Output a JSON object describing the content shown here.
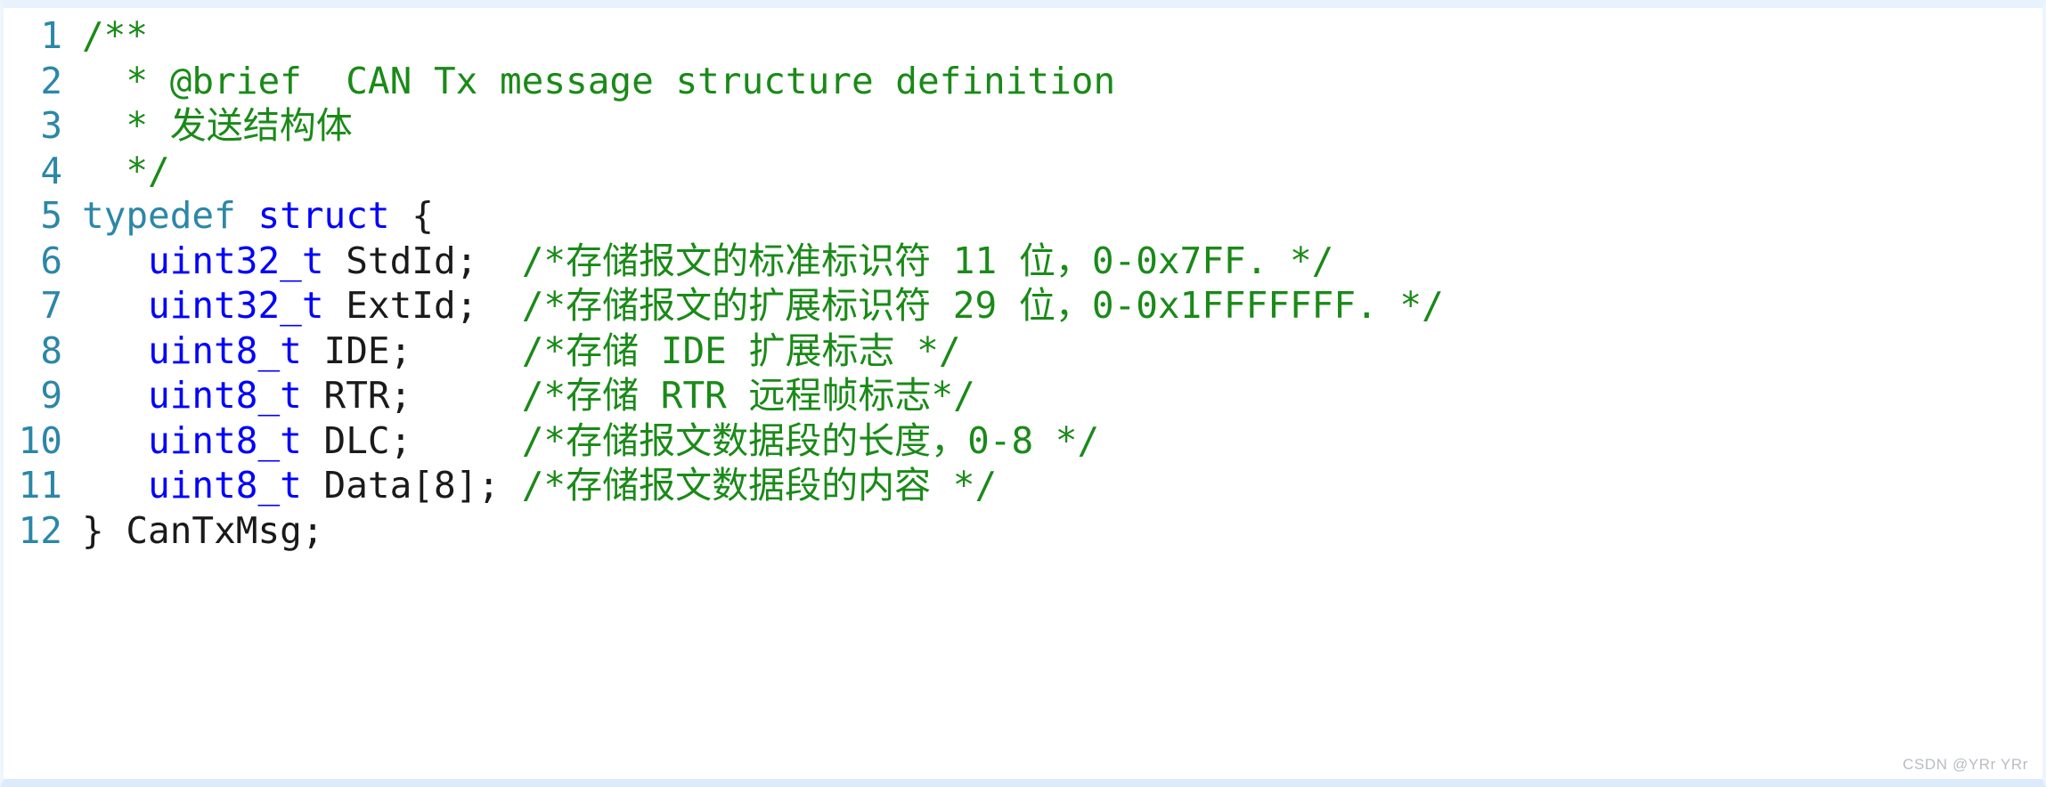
{
  "card": {
    "language": "c",
    "accent_top_color": "#e8f2fd",
    "accent_bottom_color": "#dcebfb",
    "background_color": "#ffffff"
  },
  "colors": {
    "line_number": "#2b87a8",
    "comment": "#1a8a18",
    "keyword_typedef": "#2b87a8",
    "keyword_struct": "#0000ff",
    "type": "#0000ff",
    "plain": "#1a1a1a",
    "watermark": "#b9bcc1"
  },
  "watermark": {
    "text": "CSDN @YRr YRr"
  },
  "code": {
    "lines": [
      {
        "number": "1",
        "tokens": [
          {
            "kind": "comment",
            "text": "/**"
          }
        ]
      },
      {
        "number": "2",
        "tokens": [
          {
            "kind": "comment",
            "text": "  * @brief  CAN Tx message structure definition"
          }
        ]
      },
      {
        "number": "3",
        "tokens": [
          {
            "kind": "comment",
            "text": "  * 发送结构体"
          }
        ]
      },
      {
        "number": "4",
        "tokens": [
          {
            "kind": "comment",
            "text": "  */"
          }
        ]
      },
      {
        "number": "5",
        "tokens": [
          {
            "kind": "keyword",
            "text": "typedef"
          },
          {
            "kind": "plain",
            "text": " "
          },
          {
            "kind": "struct",
            "text": "struct"
          },
          {
            "kind": "plain",
            "text": " {"
          }
        ]
      },
      {
        "number": "6",
        "tokens": [
          {
            "kind": "plain",
            "text": "   "
          },
          {
            "kind": "type",
            "text": "uint32_t"
          },
          {
            "kind": "plain",
            "text": " StdId;  "
          },
          {
            "kind": "comment",
            "text": "/*存储报文的标准标识符 11 位，0-0x7FF. */"
          }
        ]
      },
      {
        "number": "7",
        "tokens": [
          {
            "kind": "plain",
            "text": "   "
          },
          {
            "kind": "type",
            "text": "uint32_t"
          },
          {
            "kind": "plain",
            "text": " ExtId;  "
          },
          {
            "kind": "comment",
            "text": "/*存储报文的扩展标识符 29 位，0-0x1FFFFFFF. */"
          }
        ]
      },
      {
        "number": "8",
        "tokens": [
          {
            "kind": "plain",
            "text": "   "
          },
          {
            "kind": "type",
            "text": "uint8_t"
          },
          {
            "kind": "plain",
            "text": " IDE;     "
          },
          {
            "kind": "comment",
            "text": "/*存储 IDE 扩展标志 */"
          }
        ]
      },
      {
        "number": "9",
        "tokens": [
          {
            "kind": "plain",
            "text": "   "
          },
          {
            "kind": "type",
            "text": "uint8_t"
          },
          {
            "kind": "plain",
            "text": " RTR;     "
          },
          {
            "kind": "comment",
            "text": "/*存储 RTR 远程帧标志*/"
          }
        ]
      },
      {
        "number": "10",
        "tokens": [
          {
            "kind": "plain",
            "text": "   "
          },
          {
            "kind": "type",
            "text": "uint8_t"
          },
          {
            "kind": "plain",
            "text": " DLC;     "
          },
          {
            "kind": "comment",
            "text": "/*存储报文数据段的长度，0-8 */"
          }
        ]
      },
      {
        "number": "11",
        "tokens": [
          {
            "kind": "plain",
            "text": "   "
          },
          {
            "kind": "type",
            "text": "uint8_t"
          },
          {
            "kind": "plain",
            "text": " Data[8]; "
          },
          {
            "kind": "comment",
            "text": "/*存储报文数据段的内容 */"
          }
        ]
      },
      {
        "number": "12",
        "tokens": [
          {
            "kind": "plain",
            "text": "} CanTxMsg;"
          }
        ]
      }
    ]
  }
}
